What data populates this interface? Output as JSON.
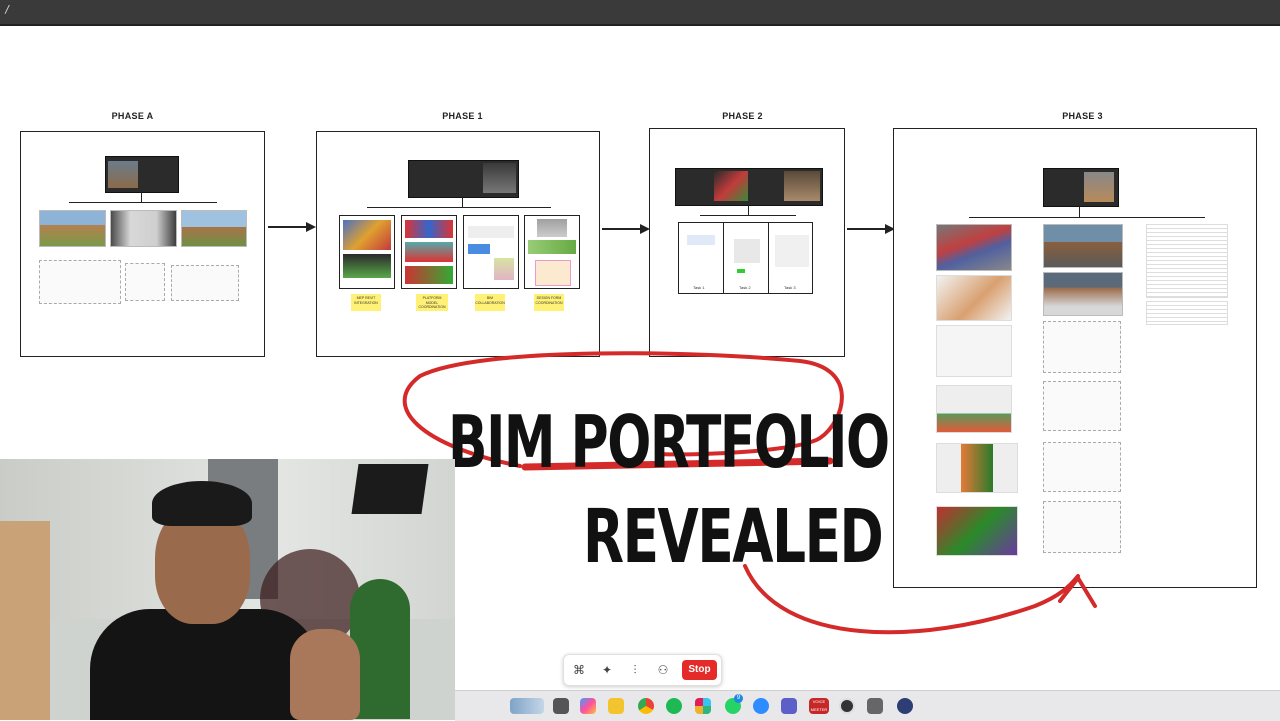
{
  "window": {
    "path_text": "/"
  },
  "phases": [
    {
      "label": "PHASE A"
    },
    {
      "label": "PHASE 1",
      "stickies": [
        "MEP REVIT INTEGRATION",
        "PLATFORM MODEL COORDINATION",
        "BIM COLLABORATION",
        "DESIGN FORM COORDINATION"
      ]
    },
    {
      "label": "PHASE 2",
      "cards": [
        "Task 1",
        "Task 2",
        "Task 3"
      ]
    },
    {
      "label": "PHASE 3"
    }
  ],
  "overlay": {
    "title_line1": "BIM PORTFOLIO",
    "title_line2": "REVEALED",
    "accent": "#d42a2a"
  },
  "recording_toolbar": {
    "stop_label": "Stop",
    "stop_color": "#e52a2a"
  },
  "taskbar": {
    "icons": [
      "app-icon",
      "file-explorer-icon",
      "copilot-icon",
      "folder-icon",
      "chrome-icon",
      "spotify-icon",
      "slack-icon",
      "whatsapp-icon",
      "zoom-icon",
      "teams-icon",
      "voice-meeter-icon",
      "obs-icon",
      "window-icon",
      "app-icon-2"
    ],
    "whatsapp_badge": "9",
    "voicemeeter_label": "VOICE MEETER"
  }
}
